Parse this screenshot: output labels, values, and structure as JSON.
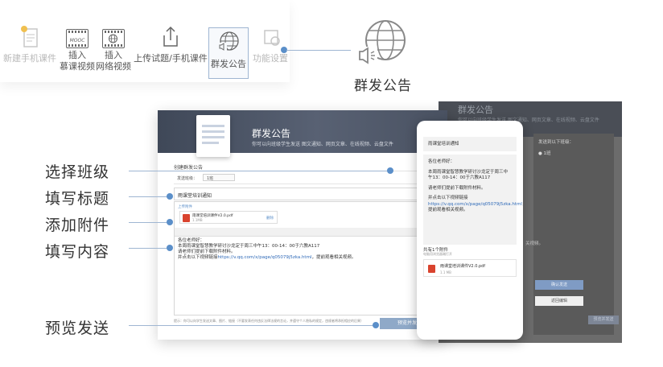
{
  "toolbar": {
    "items": [
      {
        "label_line1": "新建手机课件",
        "label_line2": "",
        "icon": "new-mobile-courseware-icon"
      },
      {
        "label_line1": "插入",
        "label_line2": "慕课视频",
        "icon": "mooc-video-icon",
        "icon_text": "MOOC"
      },
      {
        "label_line1": "插入",
        "label_line2": "网络视频",
        "icon": "web-video-icon"
      },
      {
        "label_line1": "上传试题/手机课件",
        "label_line2": "",
        "icon": "upload-icon"
      },
      {
        "label_line1": "群发公告",
        "label_line2": "",
        "icon": "broadcast-announcement-icon"
      },
      {
        "label_line1": "功能设置",
        "label_line2": "",
        "icon": "settings-icon"
      }
    ]
  },
  "feature": {
    "title": "群发公告",
    "icon": "globe-megaphone-icon"
  },
  "steps": [
    "选择班级",
    "填写标题",
    "添加附件",
    "填写内容",
    "预览发送"
  ],
  "panel": {
    "title": "群发公告",
    "subtitle": "你可以向班级学生发送 图文通知、网页文章、在线视频、云盘文件",
    "create_label": "创建群发公告",
    "class_label": "发送班级：",
    "class_value": "1班",
    "title_value": "雨课堂培训通知",
    "attach_hint": "上传附件",
    "attach_name": "雨课堂培训课件V2.0.pdf",
    "attach_size": "1.1MB",
    "attach_action": "删除",
    "body_lines": [
      "各位老师好：",
      "本周雨课堂智慧教学研讨沙龙定于周三中午13：00-14：00于六教A117",
      "请老师们提前下载附件材料。",
      "并点击以下视频链接"
    ],
    "link": "https://v.qq.com/x/page/q05079j5zka.html",
    "link_suffix": "，提前观看相关视频。",
    "footer_note": "提示：你可以向学生发送文章、图片、链接（不要发表任何违反法律法规的言论，并遵守个人隐私的规定，违规者将承担相应的后果）",
    "send_button": "预览并发送"
  },
  "phone": {
    "title": "雨课堂培训通知",
    "greeting": "各位老师好：",
    "p1": "本周雨课堂智慧教学研讨沙龙定于周三中午13：00-14：00于六教A117",
    "p2": "请老师们提前下载附件材料。",
    "p3_prefix": "并点击以下视频链接",
    "link": "https://v.qq.com/x/page/q05079j5zka.html",
    "p3_suffix": "，提前观看相关视频。",
    "attach_header": "共有1个附件",
    "attach_sub": "电脑用浏览器端打开",
    "attach_name": "雨课堂培训课件V2.0.pdf",
    "attach_size": "1.1 MB"
  },
  "background": {
    "title": "群发公告",
    "subtitle": "你可以向班级学生发送 图文通知、网页文章、在线视频、云盘文件",
    "class_label": "发送到以下班级：",
    "class_value": "● 1班",
    "confirm_button": "确认发送",
    "back_button": "返回编辑",
    "send_button": "预览并发送",
    "snippet": "关视频。"
  },
  "colors": {
    "accent": "#5b8fc9",
    "connector": "#9fb6d2",
    "header": "#4a5262",
    "send": "#8fa9c8",
    "pdf": "#d9432e"
  }
}
